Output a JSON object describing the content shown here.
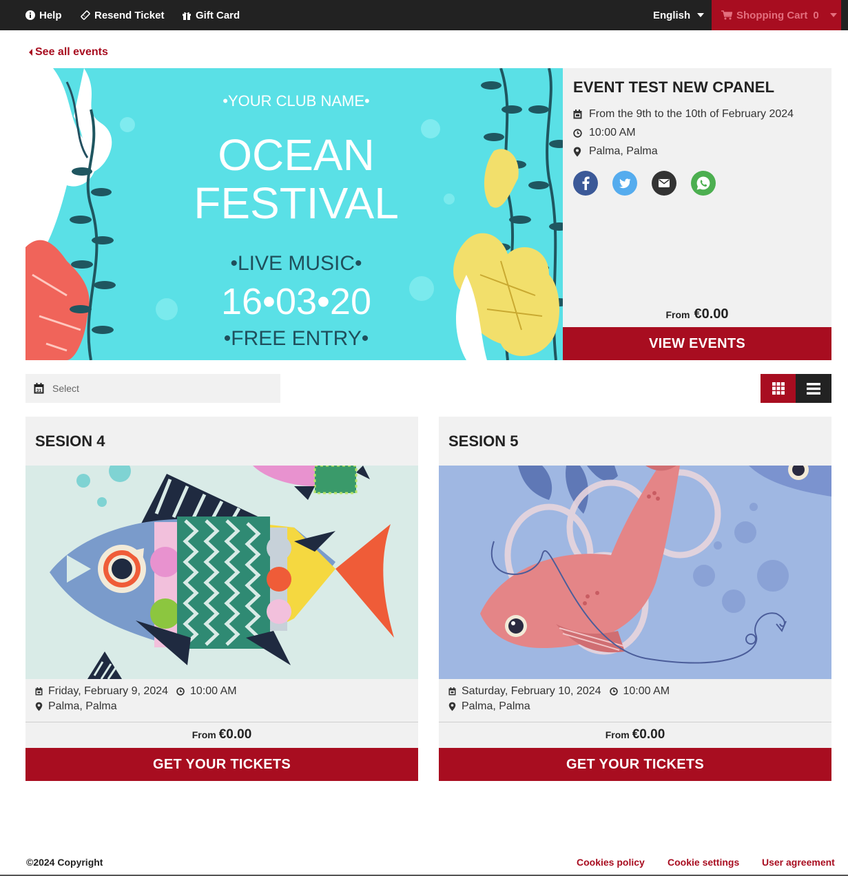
{
  "topbar": {
    "help": "Help",
    "resend": "Resend Ticket",
    "gift": "Gift Card",
    "language": "English",
    "cart_label": "Shopping Cart",
    "cart_count": "0"
  },
  "back_link": "See all events",
  "banner": {
    "club": "•YOUR CLUB NAME•",
    "line1": "OCEAN",
    "line2": "FESTIVAL",
    "music": "•LIVE MUSIC•",
    "date": "16•03•20",
    "entry": "•FREE ENTRY•"
  },
  "event": {
    "title": "EVENT TEST NEW CPANEL",
    "dates": "From the 9th to the 10th of February 2024",
    "time": "10:00 AM",
    "location": "Palma, Palma",
    "from_label": "From",
    "price": "€0.00",
    "button": "VIEW EVENTS"
  },
  "social_icons": [
    "facebook-icon",
    "twitter-icon",
    "email-icon",
    "whatsapp-icon"
  ],
  "filter": {
    "placeholder": "Select"
  },
  "sessions": [
    {
      "title": "SESION 4",
      "date": "Friday, February 9, 2024",
      "time": "10:00 AM",
      "location": "Palma, Palma",
      "from_label": "From",
      "price": "€0.00",
      "button": "GET YOUR TICKETS"
    },
    {
      "title": "SESION 5",
      "date": "Saturday, February 10, 2024",
      "time": "10:00 AM",
      "location": "Palma, Palma",
      "from_label": "From",
      "price": "€0.00",
      "button": "GET YOUR TICKETS"
    }
  ],
  "footer": {
    "copyright": "©2024 Copyright",
    "cookies_policy": "Cookies policy",
    "cookie_settings": "Cookie settings",
    "user_agreement": "User agreement"
  },
  "colors": {
    "brand_red": "#a80d20",
    "topbar": "#222222",
    "panel": "#f1f1f1",
    "facebook": "#3b5998",
    "twitter": "#55acee",
    "email": "#333333",
    "whatsapp": "#4caf50"
  }
}
